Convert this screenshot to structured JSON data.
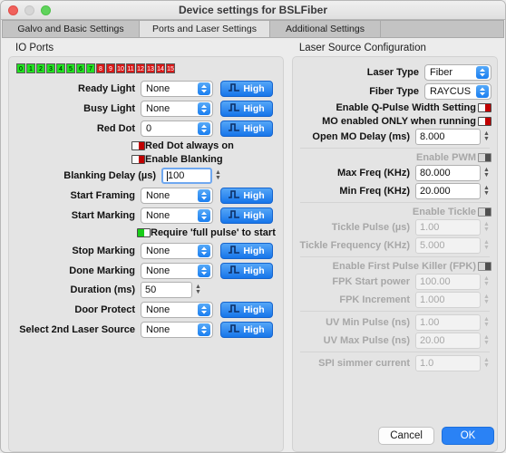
{
  "window": {
    "title": "Device settings for BSLFiber",
    "traffic_lights": [
      "close-red",
      "minimize-gray",
      "zoom-green"
    ]
  },
  "tabs": [
    {
      "label": "Galvo and Basic Settings",
      "active": false
    },
    {
      "label": "Ports and Laser Settings",
      "active": true
    },
    {
      "label": "Additional Settings",
      "active": false
    }
  ],
  "io_ports": {
    "title": "IO Ports",
    "leds": [
      {
        "n": "0",
        "state": "green"
      },
      {
        "n": "1",
        "state": "green"
      },
      {
        "n": "2",
        "state": "green"
      },
      {
        "n": "3",
        "state": "green"
      },
      {
        "n": "4",
        "state": "green"
      },
      {
        "n": "5",
        "state": "green"
      },
      {
        "n": "6",
        "state": "green"
      },
      {
        "n": "7",
        "state": "green"
      },
      {
        "n": "8",
        "state": "red"
      },
      {
        "n": "9",
        "state": "red"
      },
      {
        "n": "10",
        "state": "red"
      },
      {
        "n": "11",
        "state": "red"
      },
      {
        "n": "12",
        "state": "red"
      },
      {
        "n": "13",
        "state": "red"
      },
      {
        "n": "14",
        "state": "red"
      },
      {
        "n": "15",
        "state": "red"
      }
    ],
    "rows": [
      {
        "label": "Ready Light",
        "value": "None",
        "level": "High"
      },
      {
        "label": "Busy Light",
        "value": "None",
        "level": "High"
      },
      {
        "label": "Red Dot",
        "value": "0",
        "level": "High"
      }
    ],
    "red_dot_always_on": {
      "label": "Red Dot always on",
      "state": "off"
    },
    "enable_blanking": {
      "label": "Enable Blanking",
      "state": "off"
    },
    "blanking_delay": {
      "label": "Blanking Delay (µs)",
      "value": "100",
      "focused": true
    },
    "rows2": [
      {
        "label": "Start Framing",
        "value": "None",
        "level": "High"
      },
      {
        "label": "Start Marking",
        "value": "None",
        "level": "High"
      }
    ],
    "require_full_pulse": {
      "label": "Require 'full pulse' to start",
      "state": "on"
    },
    "rows3": [
      {
        "label": "Stop Marking",
        "value": "None",
        "level": "High"
      },
      {
        "label": "Done Marking",
        "value": "None",
        "level": "High"
      }
    ],
    "duration": {
      "label": "Duration (ms)",
      "value": "50"
    },
    "rows4": [
      {
        "label": "Door Protect",
        "value": "None",
        "level": "High"
      },
      {
        "label": "Select 2nd Laser Source",
        "value": "None",
        "level": "High"
      }
    ]
  },
  "laser_source": {
    "title": "Laser Source Configuration",
    "laser_type": {
      "label": "Laser Type",
      "value": "Fiber"
    },
    "fiber_type": {
      "label": "Fiber Type",
      "value": "RAYCUS"
    },
    "enable_q_pulse": {
      "label": "Enable Q-Pulse Width Setting",
      "state": "off"
    },
    "mo_enabled_only": {
      "label": "MO enabled ONLY when running",
      "state": "off"
    },
    "open_mo_delay": {
      "label": "Open MO Delay (ms)",
      "value": "8.000",
      "disabled": false
    },
    "enable_pwm": {
      "label": "Enable PWM",
      "state": "disabled"
    },
    "max_freq": {
      "label": "Max Freq (KHz)",
      "value": "80.000",
      "disabled": false
    },
    "min_freq": {
      "label": "Min Freq (KHz)",
      "value": "20.000",
      "disabled": false
    },
    "enable_tickle": {
      "label": "Enable Tickle",
      "state": "disabled"
    },
    "tickle_pulse": {
      "label": "Tickle Pulse (µs)",
      "value": "1.00",
      "disabled": true
    },
    "tickle_frequency": {
      "label": "Tickle Frequency (KHz)",
      "value": "5.000",
      "disabled": true
    },
    "enable_fpk": {
      "label": "Enable First Pulse Killer (FPK)",
      "state": "disabled"
    },
    "fpk_start_power": {
      "label": "FPK Start power",
      "value": "100.00",
      "disabled": true
    },
    "fpk_increment": {
      "label": "FPK Increment",
      "value": "1.000",
      "disabled": true
    },
    "uv_min_pulse": {
      "label": "UV Min Pulse (ns)",
      "value": "1.00",
      "disabled": true
    },
    "uv_max_pulse": {
      "label": "UV Max Pulse (ns)",
      "value": "20.00",
      "disabled": true
    },
    "spi_simmer_current": {
      "label": "SPI simmer current",
      "value": "1.0",
      "disabled": true
    }
  },
  "footer": {
    "cancel": "Cancel",
    "ok": "OK"
  },
  "icons": {
    "pulse": "pulse-wave-icon",
    "chevron_up": "▲",
    "chevron_down": "▼"
  }
}
